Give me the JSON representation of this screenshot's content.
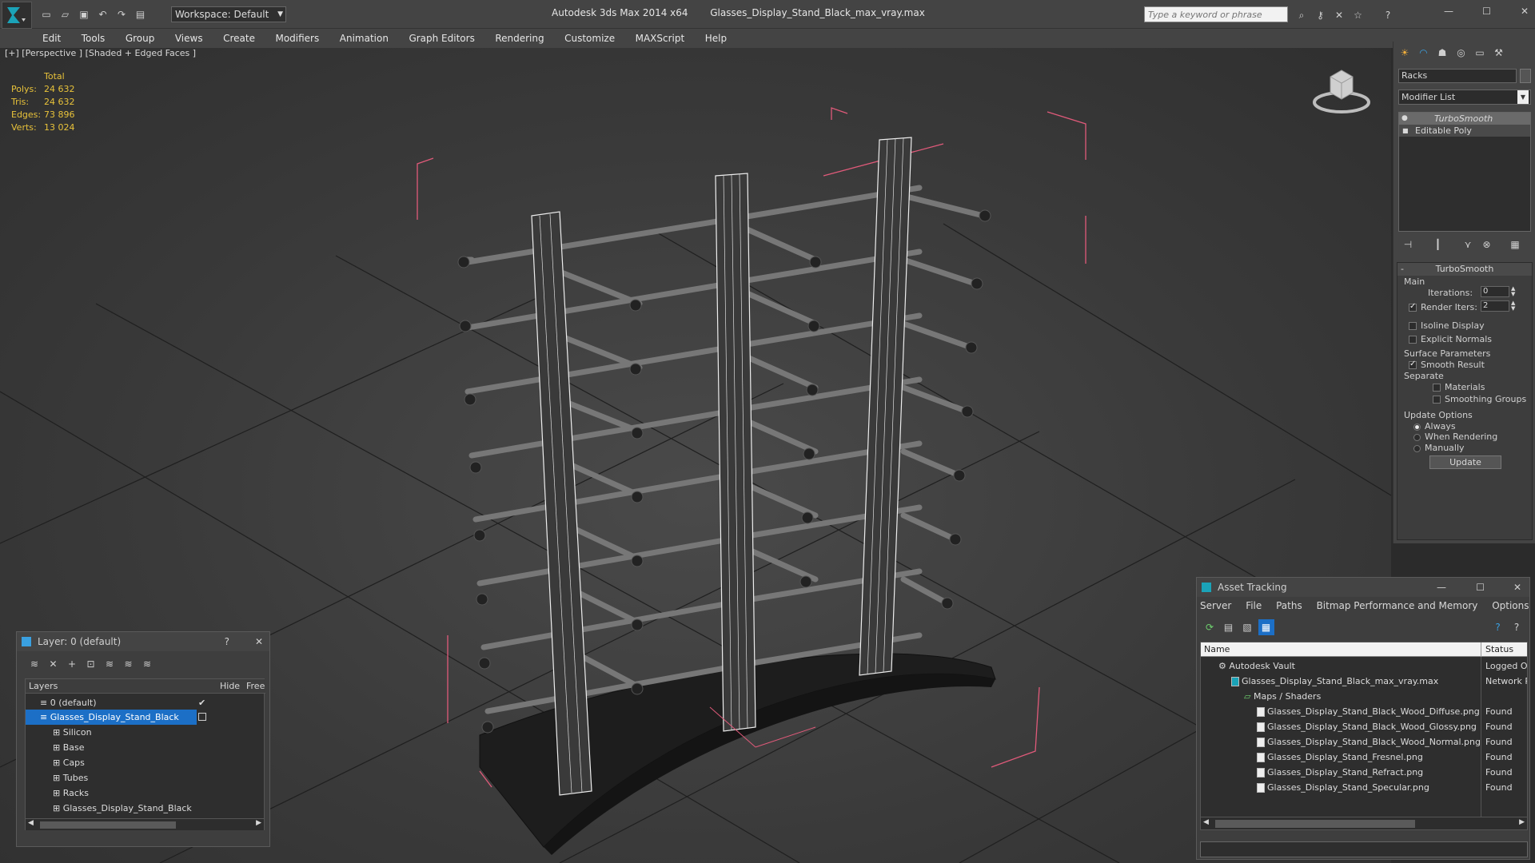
{
  "app": {
    "title": "Autodesk 3ds Max  2014 x64",
    "filename": "Glasses_Display_Stand_Black_max_vray.max",
    "workspace": "Workspace: Default",
    "search_placeholder": "Type a keyword or phrase"
  },
  "menu": [
    "Edit",
    "Tools",
    "Group",
    "Views",
    "Create",
    "Modifiers",
    "Animation",
    "Graph Editors",
    "Rendering",
    "Customize",
    "MAXScript",
    "Help"
  ],
  "viewport": {
    "label": "[+] [Perspective ] [Shaded + Edged Faces ]",
    "stats": {
      "header": "Total",
      "rows": [
        {
          "label": "Polys:",
          "value": "24 632"
        },
        {
          "label": "Tris:",
          "value": "24 632"
        },
        {
          "label": "Edges:",
          "value": "73 896"
        },
        {
          "label": "Verts:",
          "value": "13 024"
        }
      ]
    }
  },
  "command_panel": {
    "object_name": "Racks",
    "modifier_list": "Modifier List",
    "stack": [
      "TurboSmooth",
      "Editable Poly"
    ],
    "rollout_title": "TurboSmooth",
    "main_label": "Main",
    "iterations_label": "Iterations:",
    "iterations_value": "0",
    "render_iters_label": "Render Iters:",
    "render_iters_value": "2",
    "isoline_label": "Isoline Display",
    "explicit_label": "Explicit Normals",
    "surface_label": "Surface Parameters",
    "smooth_label": "Smooth Result",
    "separate_label": "Separate",
    "materials_label": "Materials",
    "smoothing_groups_label": "Smoothing Groups",
    "update_options_label": "Update Options",
    "always_label": "Always",
    "when_rendering_label": "When Rendering",
    "manually_label": "Manually",
    "update_button": "Update"
  },
  "layer_window": {
    "title": "Layer: 0 (default)",
    "help": "?",
    "col_layers": "Layers",
    "col_hide": "Hide",
    "col_freeze": "Free",
    "rows": [
      {
        "name": "0 (default)",
        "indent": 0
      },
      {
        "name": "Glasses_Display_Stand_Black",
        "indent": 0
      },
      {
        "name": "Silicon",
        "indent": 1
      },
      {
        "name": "Base",
        "indent": 1
      },
      {
        "name": "Caps",
        "indent": 1
      },
      {
        "name": "Tubes",
        "indent": 1
      },
      {
        "name": "Racks",
        "indent": 1
      },
      {
        "name": "Glasses_Display_Stand_Black",
        "indent": 1
      }
    ]
  },
  "asset_window": {
    "title": "Asset Tracking",
    "menu": [
      "Server",
      "File",
      "Paths",
      "Bitmap Performance and Memory",
      "Options"
    ],
    "col_name": "Name",
    "col_status": "Status",
    "rows": [
      {
        "name": "Autodesk Vault",
        "status": "Logged Ou",
        "indent": 1
      },
      {
        "name": "Glasses_Display_Stand_Black_max_vray.max",
        "status": "Network P",
        "indent": 2
      },
      {
        "name": "Maps / Shaders",
        "status": "",
        "indent": 3
      },
      {
        "name": "Glasses_Display_Stand_Black_Wood_Diffuse.png",
        "status": "Found",
        "indent": 4
      },
      {
        "name": "Glasses_Display_Stand_Black_Wood_Glossy.png",
        "status": "Found",
        "indent": 4
      },
      {
        "name": "Glasses_Display_Stand_Black_Wood_Normal.png",
        "status": "Found",
        "indent": 4
      },
      {
        "name": "Glasses_Display_Stand_Fresnel.png",
        "status": "Found",
        "indent": 4
      },
      {
        "name": "Glasses_Display_Stand_Refract.png",
        "status": "Found",
        "indent": 4
      },
      {
        "name": "Glasses_Display_Stand_Specular.png",
        "status": "Found",
        "indent": 4
      }
    ]
  },
  "colors": {
    "accent": "#1c6fc6",
    "stats": "#e8c23a",
    "selection_box": "#e05a7a"
  }
}
